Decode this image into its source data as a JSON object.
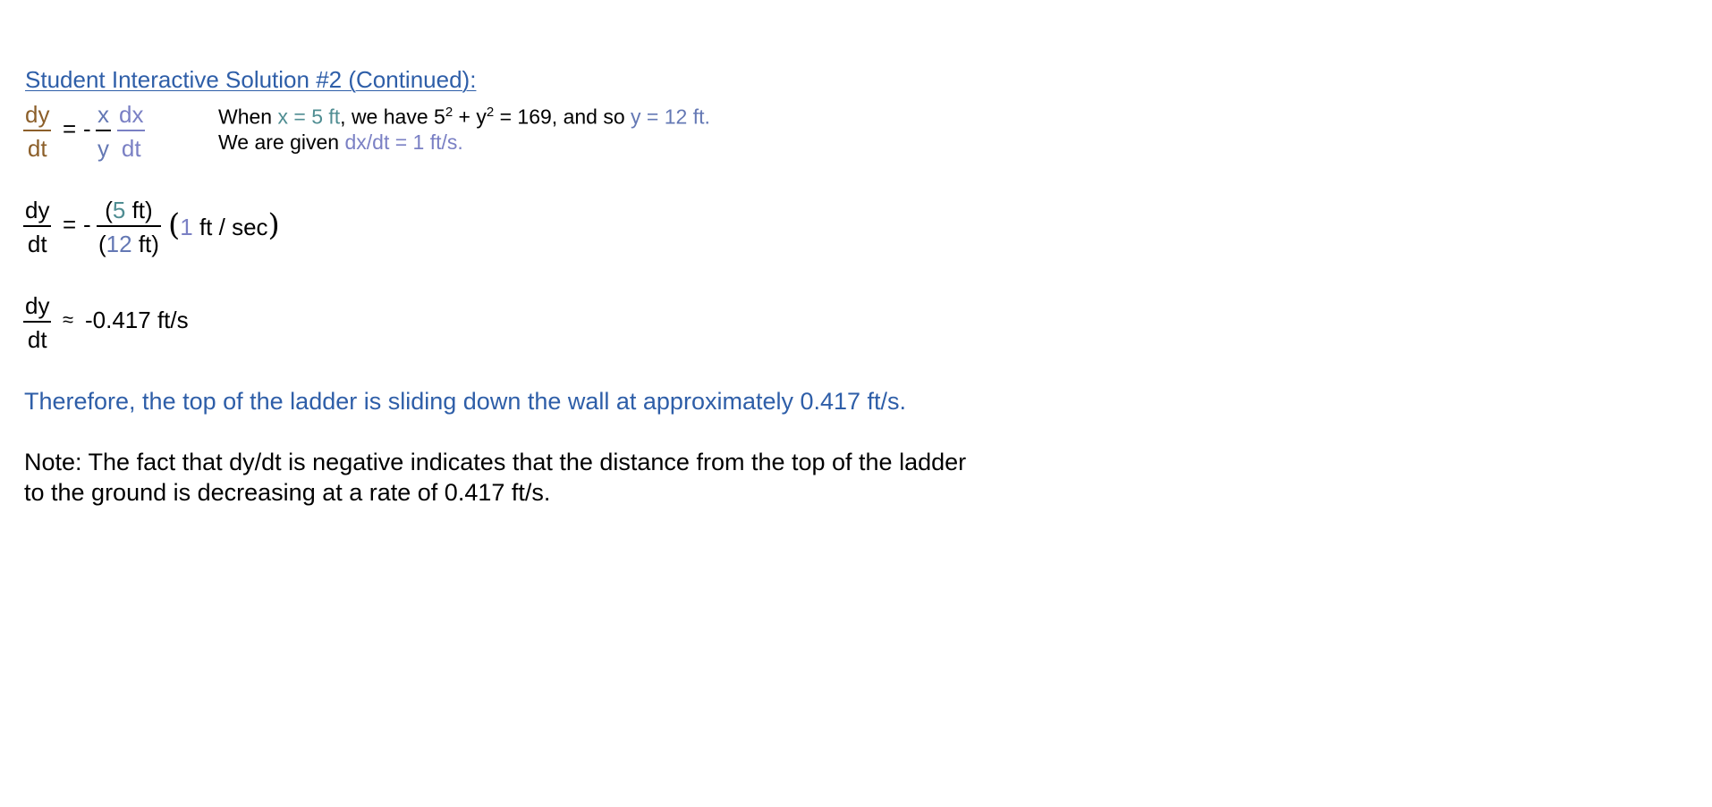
{
  "title": "Student Interactive Solution #2 (Continued):",
  "colors": {
    "title_blue": "#2e5ea8",
    "brown": "#8c5f2a",
    "teal": "#4f8d92",
    "slate": "#6478b4",
    "lavender": "#7a80c4"
  },
  "eq1": {
    "lhs_num": "dy",
    "lhs_den": "dt",
    "equals": "=",
    "minus": "-",
    "f1_num": "x",
    "f1_den": "y",
    "f2_num": "dx",
    "f2_den": "dt"
  },
  "given": {
    "line1_a": "When ",
    "line1_x": "x = 5 ft",
    "line1_b": ", we have 5",
    "line1_sup1": "2",
    "line1_c": " + y",
    "line1_sup2": "2",
    "line1_d": " = 169, and so ",
    "line1_y": "y = 12 ft",
    "line1_e": ".",
    "line2_a": "We are given ",
    "line2_rate": "dx/dt = 1 ft/s."
  },
  "eq2": {
    "lhs_num": "dy",
    "lhs_den": "dt",
    "equals": "=",
    "minus": "-",
    "num_open": "(",
    "num_val": "5",
    "num_unit": " ft)",
    "den_open": "(",
    "den_val": "12",
    "den_unit": " ft)",
    "rate_open": "(",
    "rate_val": "1",
    "rate_unit": " ft / sec",
    "rate_close": ")"
  },
  "eq3": {
    "lhs_num": "dy",
    "lhs_den": "dt",
    "approx": "≈",
    "result": "-0.417 ft/s"
  },
  "conclusion": "Therefore, the top of the ladder is sliding down the wall at approximately 0.417 ft/s.",
  "note": "Note: The fact that dy/dt is negative indicates that the distance from the top of the ladder to the ground is decreasing at a rate of 0.417 ft/s."
}
